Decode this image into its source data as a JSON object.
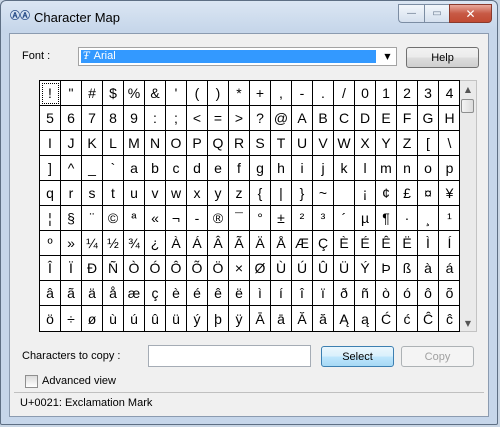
{
  "window": {
    "title": "Character Map",
    "app_icon": "character-map-icon"
  },
  "caption_buttons": {
    "minimize": "—",
    "maximize": "▭",
    "close": "✕"
  },
  "font": {
    "label": "Font :",
    "selected": "Arial",
    "type_icon": "Ŧ"
  },
  "help_label": "Help",
  "grid": {
    "rows": [
      [
        "!",
        "\"",
        "#",
        "$",
        "%",
        "&",
        "'",
        "(",
        ")",
        "*",
        "+",
        ",",
        "-",
        ".",
        "/",
        "0",
        "1",
        "2",
        "3",
        "4"
      ],
      [
        "5",
        "6",
        "7",
        "8",
        "9",
        ":",
        ";",
        "<",
        "=",
        ">",
        "?",
        "@",
        "A",
        "B",
        "C",
        "D",
        "E",
        "F",
        "G",
        "H"
      ],
      [
        "I",
        "J",
        "K",
        "L",
        "M",
        "N",
        "O",
        "P",
        "Q",
        "R",
        "S",
        "T",
        "U",
        "V",
        "W",
        "X",
        "Y",
        "Z",
        "[",
        "\\"
      ],
      [
        "]",
        "^",
        "_",
        "`",
        "a",
        "b",
        "c",
        "d",
        "e",
        "f",
        "g",
        "h",
        "i",
        "j",
        "k",
        "l",
        "m",
        "n",
        "o",
        "p"
      ],
      [
        "q",
        "r",
        "s",
        "t",
        "u",
        "v",
        "w",
        "x",
        "y",
        "z",
        "{",
        "|",
        "}",
        "~",
        " ",
        "¡",
        "¢",
        "£",
        "¤",
        "¥"
      ],
      [
        "¦",
        "§",
        "¨",
        "©",
        "ª",
        "«",
        "¬",
        "-",
        "®",
        "¯",
        "°",
        "±",
        "²",
        "³",
        "´",
        "µ",
        "¶",
        "·",
        "¸",
        "¹"
      ],
      [
        "º",
        "»",
        "¼",
        "½",
        "¾",
        "¿",
        "À",
        "Á",
        "Â",
        "Ã",
        "Ä",
        "Å",
        "Æ",
        "Ç",
        "È",
        "É",
        "Ê",
        "Ë",
        "Ì",
        "Í"
      ],
      [
        "Î",
        "Ï",
        "Ð",
        "Ñ",
        "Ò",
        "Ó",
        "Ô",
        "Õ",
        "Ö",
        "×",
        "Ø",
        "Ù",
        "Ú",
        "Û",
        "Ü",
        "Ý",
        "Þ",
        "ß",
        "à",
        "á"
      ],
      [
        "â",
        "ã",
        "ä",
        "å",
        "æ",
        "ç",
        "è",
        "é",
        "ê",
        "ë",
        "ì",
        "í",
        "î",
        "ï",
        "ð",
        "ñ",
        "ò",
        "ó",
        "ô",
        "õ"
      ]
    ],
    "extra_row": [
      "ö",
      "÷",
      "ø",
      "ù",
      "ú",
      "û",
      "ü",
      "ý",
      "þ",
      "ÿ",
      "Ā",
      "ā",
      "Ă",
      "ă",
      "Ą",
      "ą",
      "Ć",
      "ć",
      "Ĉ",
      "ĉ"
    ],
    "selected_char": "!"
  },
  "copy": {
    "label": "Characters to copy :",
    "value": ""
  },
  "select_label": "Select",
  "copy_label": "Copy",
  "advanced_view": {
    "label": "Advanced view",
    "checked": false
  },
  "status": "U+0021: Exclamation Mark"
}
